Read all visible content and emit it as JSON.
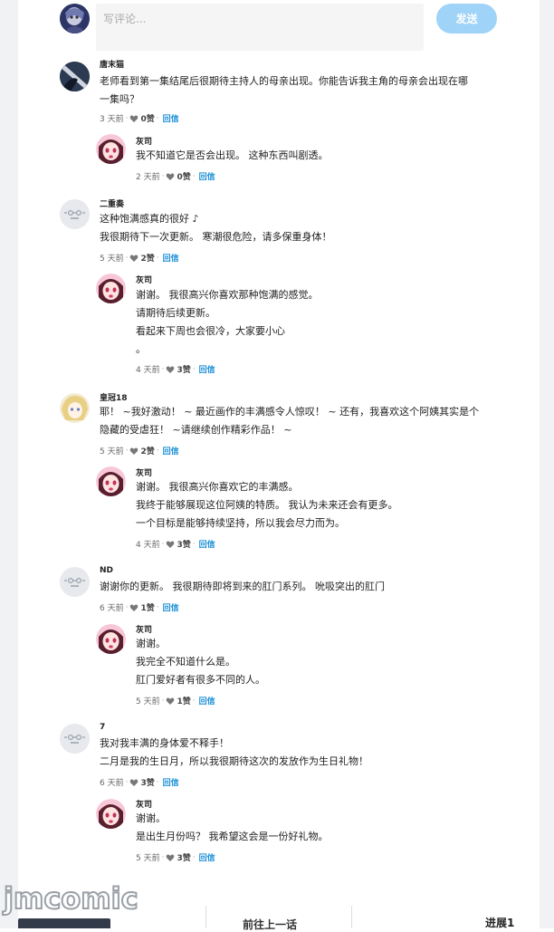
{
  "composer": {
    "placeholder": "写评论...",
    "send_label": "发送"
  },
  "comments": [
    {
      "author": "唐末猫",
      "avatar_icon": "dark-character-avatar",
      "lines": [
        "老师看到第一集结尾后很期待主持人的母亲出现。你能告诉我主角的母亲会出现在哪",
        "一集吗？"
      ],
      "time": "3 天前",
      "likes": "0赞",
      "reply_label": "回信",
      "reply": {
        "author": "灰司",
        "lines": [
          "我不知道它是否会出现。 这种东西叫剧透。"
        ],
        "time": "2 天前",
        "likes": "0赞",
        "reply_label": "回信"
      }
    },
    {
      "author": "二重奏",
      "avatar_icon": "default-avatar",
      "lines": [
        "这种饱满感真的很好 ♪",
        "我很期待下一次更新。 寒潮很危险，请多保重身体！"
      ],
      "time": "5 天前",
      "likes": "2赞",
      "reply_label": "回信",
      "reply": {
        "author": "灰司",
        "lines": [
          "谢谢。 我很高兴你喜欢那种饱满的感觉。",
          "请期待后续更新。",
          "看起来下周也会很冷，大家要小心",
          "。"
        ],
        "time": "4 天前",
        "likes": "3赞",
        "reply_label": "回信"
      }
    },
    {
      "author": "皇冠18",
      "avatar_icon": "blonde-character-avatar",
      "lines": [
        "耶！ ~我好激动！ ~ 最近画作的丰满感令人惊叹！ ~ 还有，我喜欢这个阿姨其实是个",
        "隐藏的受虐狂！ ~请继续创作精彩作品！ ~"
      ],
      "time": "5 天前",
      "likes": "2赞",
      "reply_label": "回信",
      "reply": {
        "author": "灰司",
        "lines": [
          "谢谢。 我很高兴你喜欢它的丰满感。",
          "我终于能够展现这位阿姨的特质。 我认为未来还会有更多。",
          "一个目标是能够持续坚持，所以我会尽力而为。"
        ],
        "time": "4 天前",
        "likes": "3赞",
        "reply_label": "回信"
      }
    },
    {
      "author": "ND",
      "avatar_icon": "default-avatar",
      "lines": [
        "谢谢你的更新。 我很期待即将到来的肛门系列。 吮吸突出的肛门"
      ],
      "time": "6 天前",
      "likes": "1赞",
      "reply_label": "回信",
      "reply": {
        "author": "灰司",
        "lines": [
          "谢谢。",
          "我完全不知道什么是。",
          "肛门爱好者有很多不同的人。"
        ],
        "time": "5 天前",
        "likes": "1赞",
        "reply_label": "回信"
      }
    },
    {
      "author": "7",
      "avatar_icon": "default-avatar",
      "lines": [
        "我对我丰满的身体爱不释手！",
        "二月是我的生日月，所以我很期待这次的发放作为生日礼物！"
      ],
      "time": "6 天前",
      "likes": "3赞",
      "reply_label": "回信",
      "reply": {
        "author": "灰司",
        "lines": [
          "谢谢。",
          "是出生月份吗？ 我希望这会是一份好礼物。"
        ],
        "time": "5 天前",
        "likes": "3赞",
        "reply_label": "回信"
      }
    }
  ],
  "footer": {
    "watermark": "jmcomic",
    "prev_label": "前往上一话",
    "next_label": "进展1"
  },
  "colors": {
    "accent": "#1a8fd6",
    "send_button": "#9fd3f7",
    "reply_avatar_bg": "#f7c7d8"
  }
}
